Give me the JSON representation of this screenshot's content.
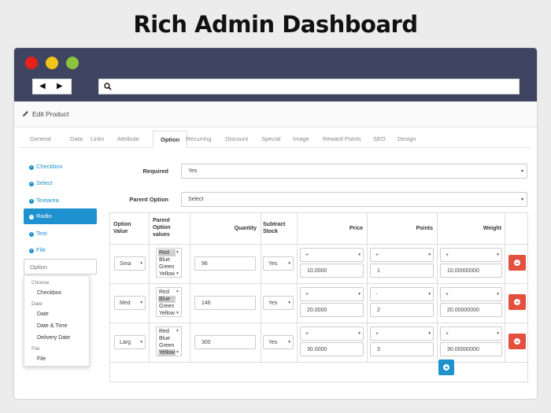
{
  "headline": "Rich Admin Dashboard",
  "browser": {
    "back_icon": "◀",
    "forward_icon": "▶",
    "search_icon": "search-icon"
  },
  "panel": {
    "title": "Edit Product",
    "icon": "pencil-icon"
  },
  "tabs": [
    "General",
    "Data",
    "Links",
    "Attribute",
    "Option",
    "Recurring",
    "Discount",
    "Special",
    "Image",
    "Reward Points",
    "SEO",
    "Design"
  ],
  "active_tab": "Option",
  "sidebar": {
    "items": [
      "Checkbox",
      "Select",
      "Textarea",
      "Radio",
      "Text",
      "File"
    ],
    "active": "Radio",
    "input_placeholder": "Option",
    "dropdown": {
      "groups": [
        {
          "label": "Choose",
          "items": [
            "Checkbox"
          ]
        },
        {
          "label": "Date",
          "items": [
            "Date",
            "Date & Time",
            "Delivery Date"
          ]
        },
        {
          "label": "File",
          "items": [
            "File"
          ]
        }
      ]
    }
  },
  "form": {
    "required_label": "Required",
    "required_value": "Yes",
    "parent_label": "Parent Option",
    "parent_value": "Select"
  },
  "table": {
    "headers": {
      "option_value": [
        "Option",
        "Value"
      ],
      "parent_values": [
        "Parent",
        "Option",
        "values"
      ],
      "quantity": "Quantity",
      "subtract": [
        "Subtract",
        "Stock"
      ],
      "price": "Price",
      "points": "Points",
      "weight": "Weight"
    },
    "rows": [
      {
        "option_value": "Sma",
        "parent_options": [
          "Red",
          "Blue",
          "Green",
          "Yellow"
        ],
        "selected": [
          "Red"
        ],
        "quantity": "96",
        "subtract": "Yes",
        "price_prefix": "+",
        "price": "10.0000",
        "points_prefix": "+",
        "points": "1",
        "weight_prefix": "+",
        "weight": "10.00000000"
      },
      {
        "option_value": "Med",
        "parent_options": [
          "Red",
          "Blue",
          "Green",
          "Yellow"
        ],
        "selected": [
          "Blue"
        ],
        "quantity": "146",
        "subtract": "Yes",
        "price_prefix": "+",
        "price": "20.0000",
        "points_prefix": "-",
        "points": "2",
        "weight_prefix": "+",
        "weight": "20.00000000"
      },
      {
        "option_value": "Larg",
        "parent_options": [
          "Red",
          "Blue",
          "Green",
          "Yellow"
        ],
        "selected": [
          "Yellow"
        ],
        "quantity": "300",
        "subtract": "Yes",
        "price_prefix": "+",
        "price": "30.0000",
        "points_prefix": "+",
        "points": "3",
        "weight_prefix": "+",
        "weight": "30.00000000"
      }
    ]
  },
  "colors": {
    "browser_bar": "#3f4461",
    "accent": "#1e91cf",
    "danger": "#e3503e"
  }
}
